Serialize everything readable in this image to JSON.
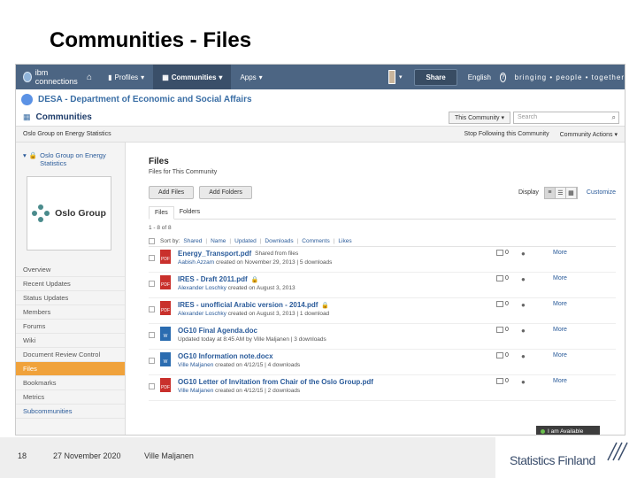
{
  "slide": {
    "title": "Communities - Files",
    "page_number": "18",
    "date": "27 November 2020",
    "author": "Ville Maljanen",
    "brand": "Statistics Finland"
  },
  "topbar": {
    "app_name": "ibm connections",
    "nav_profiles": "Profiles",
    "nav_communities": "Communities",
    "nav_apps": "Apps",
    "share": "Share",
    "language": "English",
    "help": "?",
    "tagline": "bringing • people • together"
  },
  "org": {
    "name": "DESA - Department of Economic and Social Affairs"
  },
  "communities_bar": {
    "title": "Communities",
    "scope": "This Community",
    "search_placeholder": "Search"
  },
  "breadcrumb": {
    "community": "Oslo Group on Energy Statistics",
    "stop_following": "Stop Following this Community",
    "actions": "Community Actions"
  },
  "sidebar": {
    "group_name": "Oslo Group on Energy Statistics",
    "logo_text": "Oslo Group",
    "items": [
      "Overview",
      "Recent Updates",
      "Status Updates",
      "Members",
      "Forums",
      "Wiki",
      "Document Review Control",
      "Files",
      "Bookmarks",
      "Metrics",
      "Subcommunities"
    ],
    "active_item": "Files"
  },
  "files_panel": {
    "title": "Files",
    "subtitle": "Files for This Community",
    "add_files": "Add Files",
    "add_folders": "Add Folders",
    "display_label": "Display",
    "customize": "Customize",
    "tabs": [
      "Files",
      "Folders"
    ],
    "count": "1 - 8 of 8",
    "sort_label": "Sort by:",
    "sort_options": [
      "Shared",
      "Name",
      "Updated",
      "Downloads",
      "Comments",
      "Likes"
    ]
  },
  "files": [
    {
      "type": "pdf",
      "name": "Energy_Transport.pdf",
      "locked": false,
      "shared": "Shared from files",
      "author": "Aabish Azzam",
      "meta": "created on November 29, 2013 | 5 downloads",
      "comments": "0"
    },
    {
      "type": "pdf",
      "name": "IRES - Draft 2011.pdf",
      "locked": true,
      "shared": "",
      "author": "Alexander Loschky",
      "meta": "created on August 3, 2013",
      "comments": "0"
    },
    {
      "type": "pdf",
      "name": "IRES - unofficial Arabic version - 2014.pdf",
      "locked": true,
      "shared": "",
      "author": "Alexander Loschky",
      "meta": "created on August 3, 2013 | 1 download",
      "comments": "0"
    },
    {
      "type": "doc",
      "name": "OG10 Final Agenda.doc",
      "locked": false,
      "shared": "",
      "author": "",
      "meta": "Updated today at 8:45 AM by Ville Maljanen | 3 downloads",
      "comments": "0"
    },
    {
      "type": "doc",
      "name": "OG10 Information note.docx",
      "locked": false,
      "shared": "",
      "author": "Ville Maljanen",
      "meta": "created on 4/12/15 | 4 downloads",
      "comments": "0"
    },
    {
      "type": "pdf",
      "name": "OG10 Letter of Invitation from Chair of the Oslo Group.pdf",
      "locked": false,
      "shared": "",
      "author": "Ville Maljanen",
      "meta": "created on 4/12/15 | 2 downloads",
      "comments": "0"
    }
  ],
  "more_label": "More",
  "chat": {
    "status": "I am Available"
  }
}
